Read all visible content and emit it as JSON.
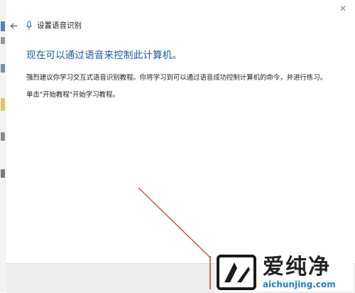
{
  "window": {
    "close_glyph": "✕",
    "nav_title": "设置语音识别",
    "back_icon": "arrow-left-icon",
    "mic_icon": "microphone-icon"
  },
  "content": {
    "heading": "现在可以通过语音来控制此计算机。",
    "paragraph1": "强烈建议你学习交互式语音识别教程。你将学习到可以通过语音成功控制计算机的命令，并进行练习。",
    "paragraph2": "单击\"开始教程\"开始学习教程。"
  },
  "watermark": {
    "brand": "爱纯净",
    "url": "aichunjing.com"
  },
  "colors": {
    "heading": "#1b58a5",
    "annotation": "#d42a2a",
    "watermark_url": "#1d7fd0"
  }
}
